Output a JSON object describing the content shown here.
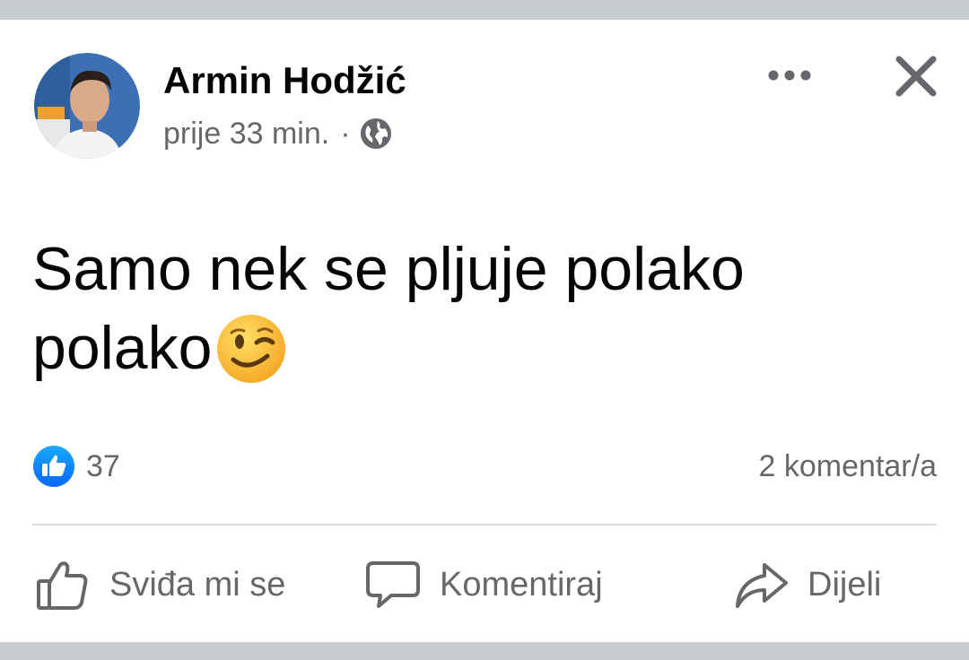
{
  "post": {
    "author": "Armin Hodžić",
    "time": "prije 33 min.",
    "separator": "·",
    "privacy_icon": "globe-icon",
    "text_line1": "Samo nek se pljuje polako",
    "text_line2": "polako",
    "emoji": "winking-face",
    "like_count": "37",
    "comments": "2 komentar/a"
  },
  "actions": {
    "like": "Sviđa mi se",
    "comment": "Komentiraj",
    "share": "Dijeli"
  },
  "colors": {
    "like_blue": "#1877f2",
    "muted_text": "#65676b",
    "frame_gray": "#c9ccd1"
  }
}
